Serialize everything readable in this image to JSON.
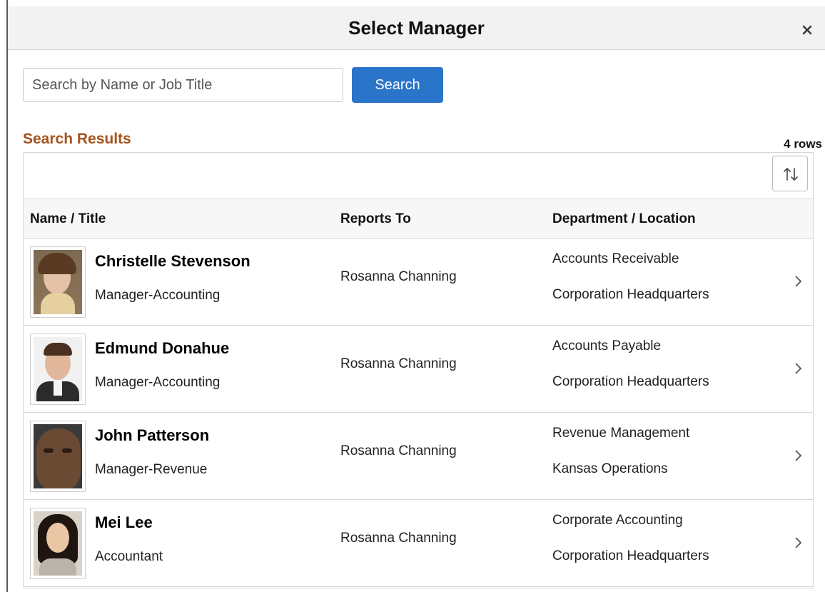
{
  "dialog": {
    "title": "Select Manager",
    "close_label": "×"
  },
  "search": {
    "placeholder": "Search by Name or Job Title",
    "value": "",
    "button_label": "Search"
  },
  "results": {
    "heading": "Search Results",
    "row_count": "4 rows",
    "columns": [
      "Name / Title",
      "Reports To",
      "Department / Location"
    ],
    "rows": [
      {
        "name": "Christelle Stevenson",
        "title": "Manager-Accounting",
        "reports_to": "Rosanna Channing",
        "department": "Accounts Receivable",
        "location": "Corporation Headquarters",
        "photo": "woman-portrait"
      },
      {
        "name": "Edmund Donahue",
        "title": "Manager-Accounting",
        "reports_to": "Rosanna Channing",
        "department": "Accounts Payable",
        "location": "Corporation Headquarters",
        "photo": "man-portrait"
      },
      {
        "name": "John Patterson",
        "title": "Manager-Revenue",
        "reports_to": "Rosanna Channing",
        "department": "Revenue Management",
        "location": "Kansas Operations",
        "photo": "man-portrait"
      },
      {
        "name": "Mei Lee",
        "title": "Accountant",
        "reports_to": "Rosanna Channing",
        "department": "Corporate Accounting",
        "location": "Corporation Headquarters",
        "photo": "woman-portrait"
      }
    ]
  },
  "colors": {
    "header_bg": "#f2f2f2",
    "primary_button": "#2a74c9",
    "results_heading": "#a5521f"
  }
}
